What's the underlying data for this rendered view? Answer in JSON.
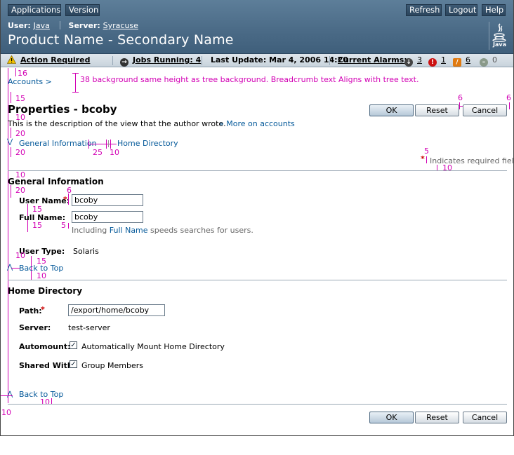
{
  "masthead": {
    "buttons": {
      "applications": "Applications",
      "version": "Version",
      "refresh": "Refresh",
      "logout": "Logout",
      "help": "Help"
    },
    "user_label": "User:",
    "user_value": "Java",
    "server_label": "Server:",
    "server_value": "Syracuse",
    "product_name": "Product Name - Secondary Name",
    "logo_text": "Java"
  },
  "statusbar": {
    "action_required": "Action Required",
    "jobs_running": "Jobs Running: 4",
    "last_update": "Last Update: Mar 4, 2006 14:20",
    "current_alarms": "Current Alarms:",
    "alarms": {
      "down": "3",
      "critical": "1",
      "major": "6",
      "minor": "0"
    },
    "colors": {
      "critical": "#cc1111",
      "major": "#e07a10",
      "minor": "#8a9a8a",
      "down": "#444444"
    }
  },
  "breadcrumb": {
    "accounts": "Accounts >"
  },
  "annotations": {
    "a16": "16",
    "a38": "38 background same height as tree background. Breadcrumb text Aligns with tree text.",
    "a15_title": "15",
    "a6_left": "6",
    "a6_right": "6",
    "a10_desc": "10",
    "a20_jump": "20",
    "a20_jump2": "20",
    "a25": "25",
    "a10_jumpgap": "10",
    "a5_req": "5",
    "a10_req": "10",
    "a10_hr": "10",
    "a20_sect": "20",
    "a6_field": "6",
    "a15_field": "15",
    "a15_field2": "15",
    "a5_help": "5",
    "a10_btt": "10",
    "a15_btt": "15",
    "a10_btt2": "10",
    "a10_bottom": "10",
    "a10_left": "10"
  },
  "page": {
    "title": "Properties - bcoby",
    "description": "This is the description of the view that the author wrote.",
    "more_link": "More on accounts",
    "ok": "OK",
    "reset": "Reset",
    "cancel": "Cancel",
    "jump_general": "General Information",
    "jump_home": "Home Directory",
    "required_legend": "Indicates required field"
  },
  "general": {
    "title": "General Information",
    "user_name_label": "User Name:",
    "user_name_value": "bcoby",
    "full_name_label": "Full Name:",
    "full_name_value": "bcoby",
    "help_prefix": "Including ",
    "help_link": "Full Name",
    "help_suffix": " speeds searches for users.",
    "user_type_label": "User Type:",
    "user_type_value": "Solaris",
    "back_to_top": "Back to Top"
  },
  "home": {
    "title": "Home Directory",
    "path_label": "Path:",
    "path_value": "/export/home/bcoby",
    "server_label": "Server:",
    "server_value": "test-server",
    "automount_label": "Automount:",
    "automount_text": "Automatically Mount Home Directory",
    "shared_label": "Shared With:",
    "shared_text": "Group Members",
    "back_to_top": "Back to Top"
  }
}
